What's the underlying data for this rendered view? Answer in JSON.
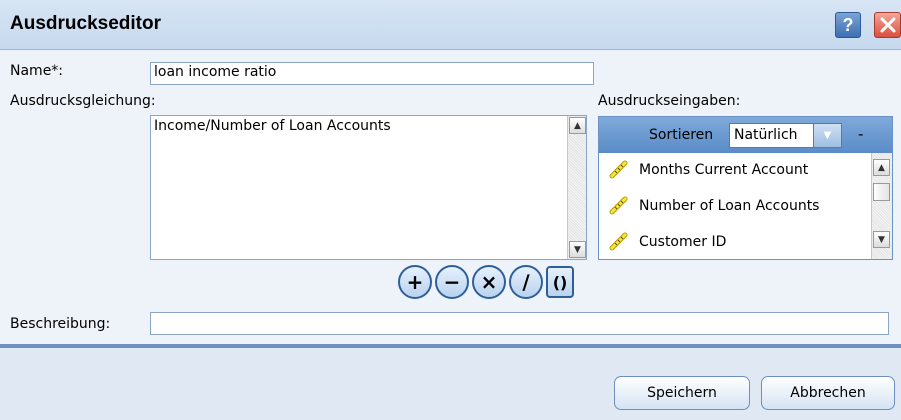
{
  "window": {
    "title": "Ausdruckseditor"
  },
  "title_buttons": {
    "help": "?"
  },
  "form": {
    "name_label": "Name*:",
    "name_value": "loan income ratio",
    "equation_label": "Ausdrucksgleichung:",
    "equation_value": "Income/Number of Loan Accounts",
    "description_label": "Beschreibung:",
    "description_value": ""
  },
  "operators": [
    {
      "name": "plus",
      "symbol": "+"
    },
    {
      "name": "minus",
      "symbol": "−"
    },
    {
      "name": "multiply",
      "symbol": "×"
    },
    {
      "name": "divide",
      "symbol": "∕"
    },
    {
      "name": "parentheses",
      "symbol": "()"
    }
  ],
  "inputs": {
    "label": "Ausdruckseingaben:",
    "sort_label": "Sortieren",
    "sort_value": "Natürlich",
    "collapse_symbol": "-",
    "items": [
      {
        "label": "Months Current Account",
        "icon": "ruler-icon"
      },
      {
        "label": "Number of Loan Accounts",
        "icon": "ruler-icon"
      },
      {
        "label": "Customer ID",
        "icon": "ruler-icon"
      }
    ]
  },
  "footer": {
    "save_label": "Speichern",
    "cancel_label": "Abbrechen"
  },
  "colors": {
    "titlebar": "#c6d9ee",
    "panel_header": "#5b8cc8",
    "close_button": "#d9503f",
    "accent_border": "#2f5f9a"
  }
}
